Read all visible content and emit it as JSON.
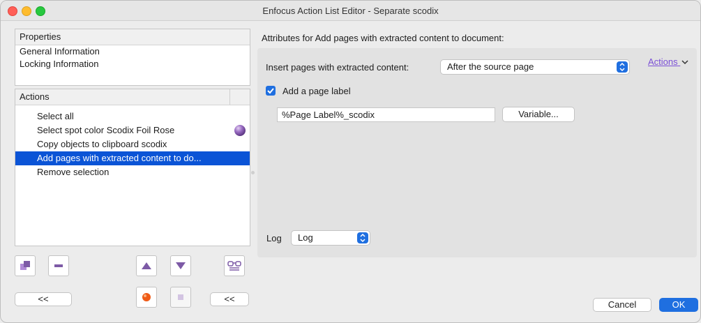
{
  "window": {
    "title": "Enfocus Action List Editor - Separate scodix"
  },
  "properties": {
    "header": "Properties",
    "items": [
      "General Information",
      "Locking Information"
    ]
  },
  "actions_panel": {
    "header": "Actions",
    "items": [
      "Select all",
      "Select spot color Scodix Foil Rose",
      "Copy objects to clipboard scodix",
      "Add pages with extracted content to do...",
      "Remove selection"
    ],
    "selected_index": 3
  },
  "left_buttons": {
    "collapse_left": "<<",
    "collapse_right": "<<"
  },
  "attributes": {
    "title": "Attributes for Add pages with extracted content to document:",
    "insert_label": "Insert pages with extracted content:",
    "insert_value": "After the source page",
    "actions_link": "Actions",
    "add_label_checkbox": "Add a page label",
    "page_label_value": "%Page Label%_scodix",
    "variable_button": "Variable...",
    "log_label": "Log",
    "log_value": "Log"
  },
  "footer": {
    "cancel": "Cancel",
    "ok": "OK"
  },
  "colors": {
    "accent": "#1f6fe0",
    "selection": "#0b54d6",
    "link": "#7b4fd6"
  }
}
